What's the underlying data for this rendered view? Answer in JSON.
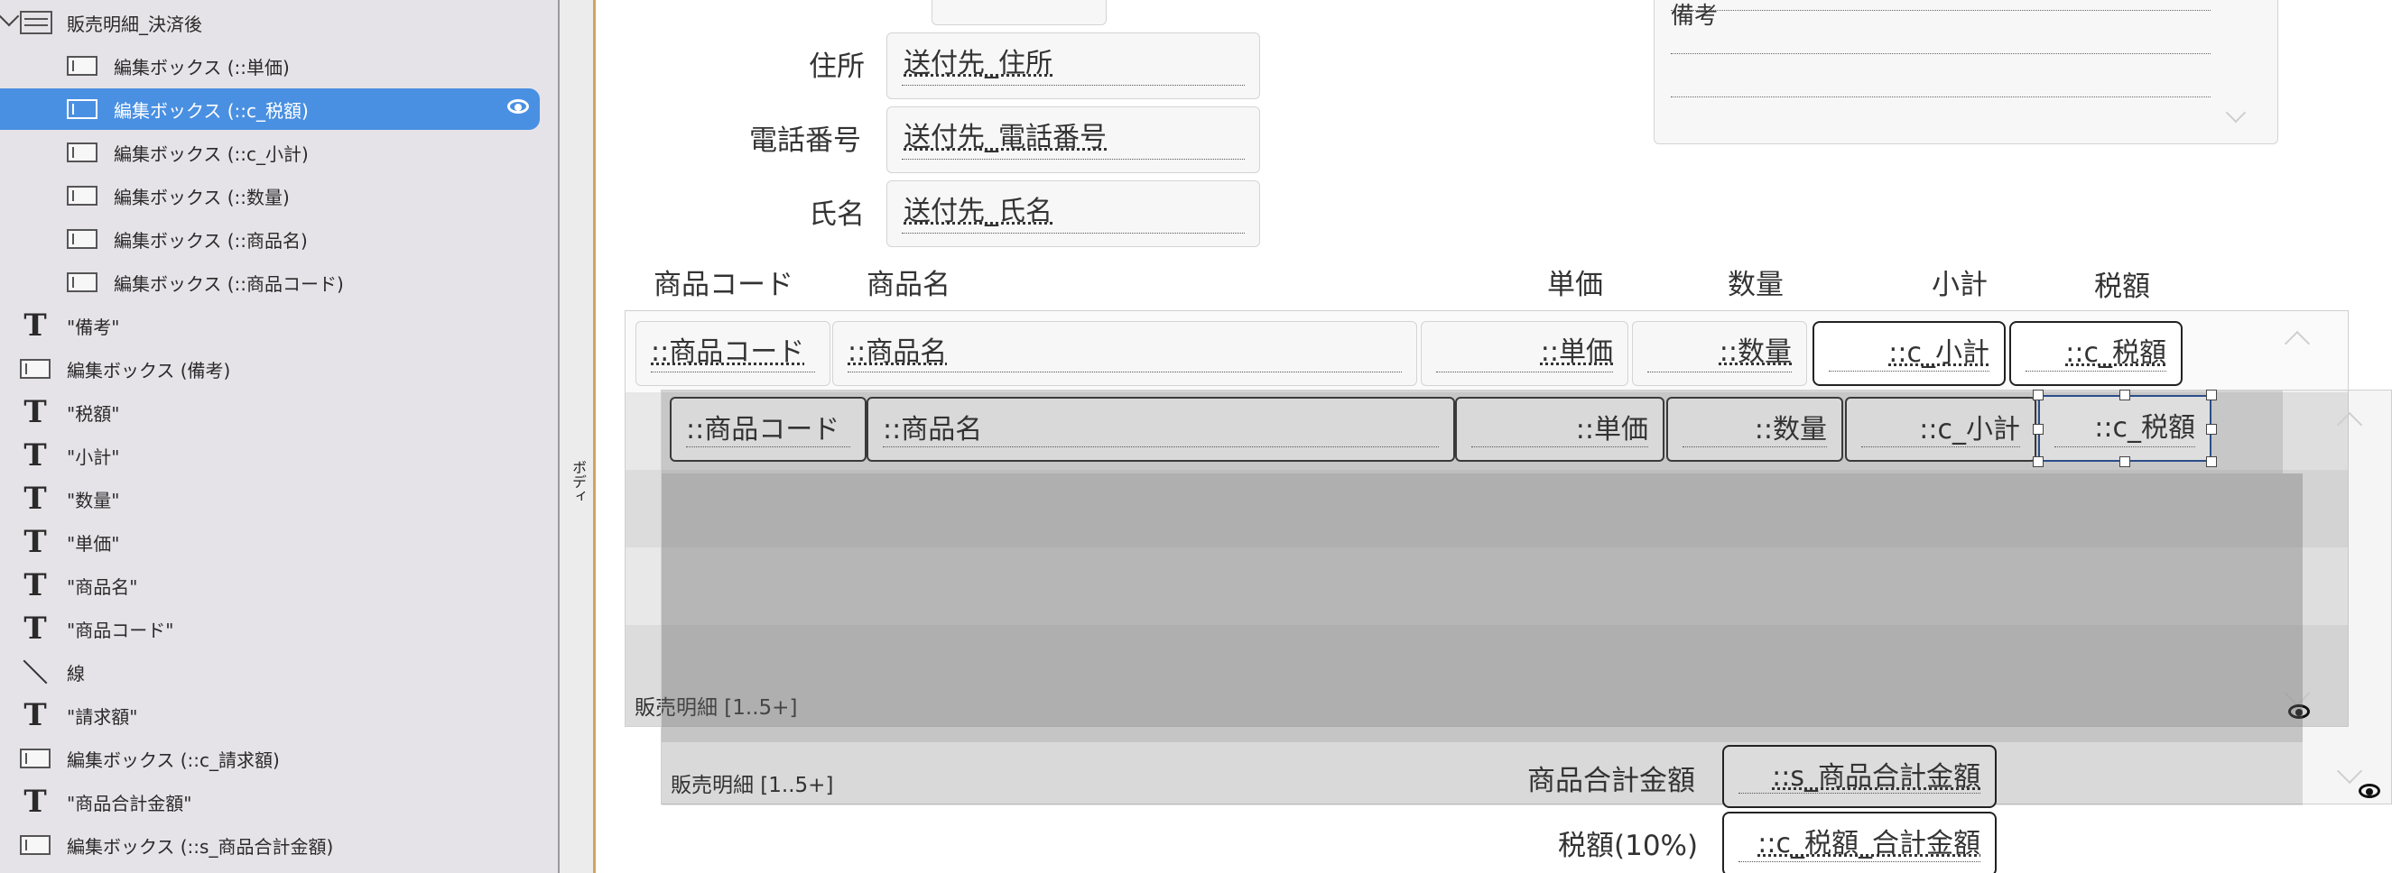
{
  "tree": {
    "items": [
      {
        "icon": "list",
        "label": "販売明細_決済後",
        "chevron": true
      },
      {
        "icon": "box",
        "label": "編集ボックス (::単価)"
      },
      {
        "icon": "box",
        "label": "編集ボックス (::c_税額)",
        "selected": true
      },
      {
        "icon": "box",
        "label": "編集ボックス (::c_小計)"
      },
      {
        "icon": "box",
        "label": "編集ボックス (::数量)"
      },
      {
        "icon": "box",
        "label": "編集ボックス (::商品名)"
      },
      {
        "icon": "box",
        "label": "編集ボックス (::商品コード)"
      },
      {
        "icon": "text",
        "label": "\"備考\""
      },
      {
        "icon": "box",
        "label": "編集ボックス (備考)"
      },
      {
        "icon": "text",
        "label": "\"税額\""
      },
      {
        "icon": "text",
        "label": "\"小計\""
      },
      {
        "icon": "text",
        "label": "\"数量\""
      },
      {
        "icon": "text",
        "label": "\"単価\""
      },
      {
        "icon": "text",
        "label": "\"商品名\""
      },
      {
        "icon": "text",
        "label": "\"商品コード\""
      },
      {
        "icon": "line",
        "label": "線"
      },
      {
        "icon": "text",
        "label": "\"請求額\""
      },
      {
        "icon": "box",
        "label": "編集ボックス (::c_請求額)"
      },
      {
        "icon": "text",
        "label": "\"商品合計金額\""
      },
      {
        "icon": "box",
        "label": "編集ボックス (::s_商品合計金額)"
      }
    ]
  },
  "part_label": "ボディ",
  "form": {
    "address_label": "住所",
    "address_value": "送付先_住所",
    "phone_label": "電話番号",
    "phone_value": "送付先_電話番号",
    "name_label": "氏名",
    "name_value": "送付先_氏名",
    "memo_value": "備考"
  },
  "headers": {
    "code": "商品コード",
    "name": "商品名",
    "price": "単価",
    "qty": "数量",
    "subtotal": "小計",
    "tax": "税額"
  },
  "portal1": {
    "code": "::商品コード",
    "name": "::商品名",
    "price": "::単価",
    "qty": "::数量",
    "subtotal": "::c_小計",
    "tax": "::c_税額",
    "caption": "販売明細 [1..5+]"
  },
  "portal2": {
    "code": "::商品コード",
    "name": "::商品名",
    "price": "::単価",
    "qty": "::数量",
    "subtotal": "::c_小計",
    "tax": "::c_税額",
    "caption": "販売明細 [1..5+]"
  },
  "totals": {
    "sum_label": "商品合計金額",
    "sum_value": "::s_商品合計金額",
    "tax_label": "税額(10%)",
    "tax_value": "::c_税額_合計金額"
  },
  "colors": {
    "selection": "#4a90e2",
    "part_border": "#d6a25a"
  }
}
